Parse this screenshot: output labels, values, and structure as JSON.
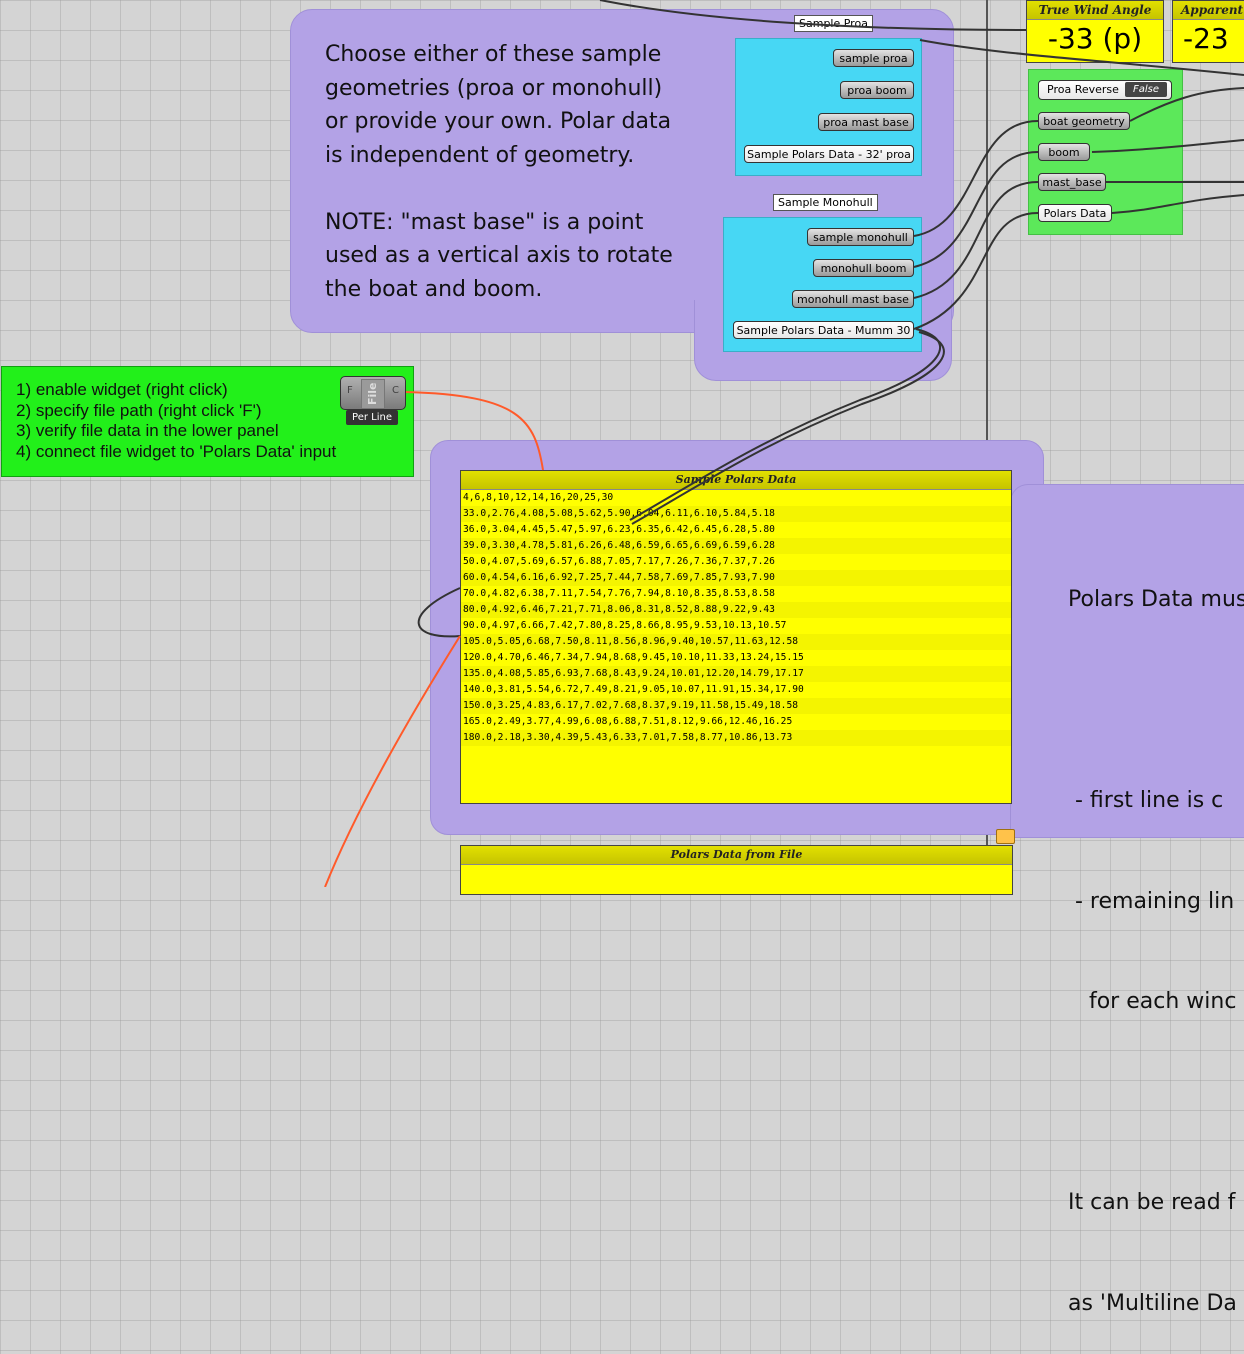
{
  "note_top": {
    "lines": [
      "Choose either of these sample",
      "geometries (proa or monohull)",
      "or provide your own.  Polar data",
      "is independent of geometry.",
      "",
      "NOTE: \"mast base\" is a point",
      "used as a vertical axis to rotate",
      "the boat and boom."
    ]
  },
  "sample_proa": {
    "label": "Sample Proa",
    "params": [
      "sample proa",
      "proa boom",
      "proa mast base",
      "Sample Polars Data - 32' proa"
    ]
  },
  "sample_monohull": {
    "label": "Sample Monohull",
    "params": [
      "sample monohull",
      "monohull boom",
      "monohull mast base",
      "Sample Polars Data - Mumm 30"
    ]
  },
  "gauges": [
    {
      "title": "True Wind Angle",
      "value": "-33 (p)"
    },
    {
      "title": "Apparent Wi",
      "value": "-23"
    }
  ],
  "inputs": {
    "toggle_label": "Proa Reverse",
    "toggle_value": "False",
    "params": [
      "boat geometry",
      "boom",
      "mast_base",
      "Polars Data"
    ]
  },
  "instructions": {
    "lines": [
      "1) enable widget (right click)",
      "2) specify file path (right click 'F')",
      "3) verify file data in the lower panel",
      "4) connect file widget to 'Polars Data' input"
    ],
    "widget_left": "F",
    "widget_center": "File",
    "widget_right": "C",
    "widget_caption": "Per Line"
  },
  "sample_polars_panel": {
    "title": "Sample Polars Data",
    "lines": [
      "4,6,8,10,12,14,16,20,25,30",
      "33.0,2.76,4.08,5.08,5.62,5.90,6.04,6.11,6.10,5.84,5.18",
      "36.0,3.04,4.45,5.47,5.97,6.23,6.35,6.42,6.45,6.28,5.80",
      "39.0,3.30,4.78,5.81,6.26,6.48,6.59,6.65,6.69,6.59,6.28",
      "50.0,4.07,5.69,6.57,6.88,7.05,7.17,7.26,7.36,7.37,7.26",
      "60.0,4.54,6.16,6.92,7.25,7.44,7.58,7.69,7.85,7.93,7.90",
      "70.0,4.82,6.38,7.11,7.54,7.76,7.94,8.10,8.35,8.53,8.58",
      "80.0,4.92,6.46,7.21,7.71,8.06,8.31,8.52,8.88,9.22,9.43",
      "90.0,4.97,6.66,7.42,7.80,8.25,8.66,8.95,9.53,10.13,10.57",
      "105.0,5.05,6.68,7.50,8.11,8.56,8.96,9.40,10.57,11.63,12.58",
      "120.0,4.70,6.46,7.34,7.94,8.68,9.45,10.10,11.33,13.24,15.15",
      "135.0,4.08,5.85,6.93,7.68,8.43,9.24,10.01,12.20,14.79,17.17",
      "140.0,3.81,5.54,6.72,7.49,8.21,9.05,10.07,11.91,15.34,17.90",
      "150.0,3.25,4.83,6.17,7.02,7.68,8.37,9.19,11.58,15.49,18.58",
      "165.0,2.49,3.77,4.99,6.08,6.88,7.51,8.12,9.66,12.46,16.25",
      "180.0,2.18,3.30,4.39,5.43,6.33,7.01,7.58,8.77,10.86,13.73"
    ]
  },
  "note_right": {
    "lines": [
      "Polars Data mus",
      "",
      " - first line is c",
      " - remaining lin",
      "   for each winc",
      "",
      "It can be read f",
      "as 'Multiline Da"
    ]
  },
  "file_panel": {
    "title": "Polars Data from File"
  },
  "colors": {
    "group_purple": "#b3a2e6",
    "cyan": "#47d7f4",
    "green": "#22f01a",
    "yellow": "#ffff00",
    "wire": "#ff5a2a"
  }
}
